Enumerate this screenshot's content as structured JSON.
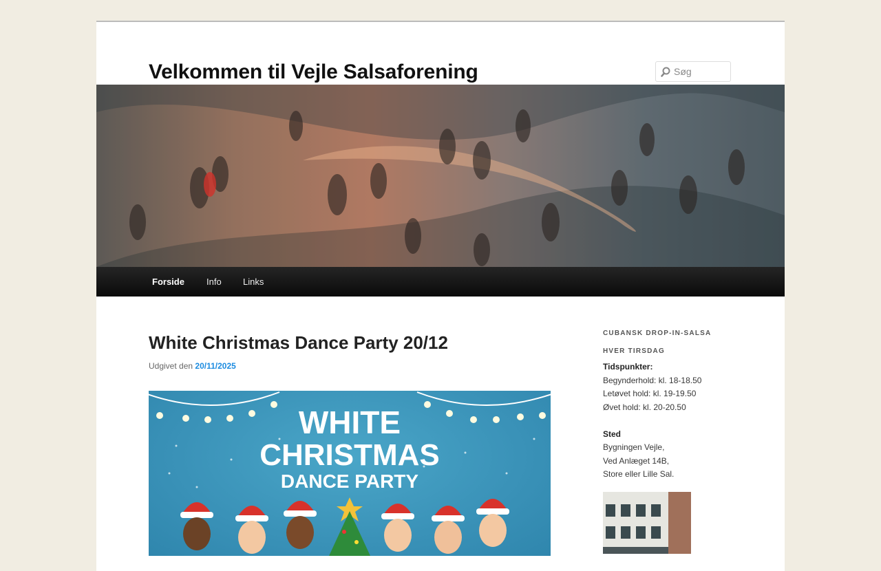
{
  "site": {
    "title": "Velkommen til Vejle Salsaforening"
  },
  "search": {
    "placeholder": "Søg",
    "icon": "search-icon"
  },
  "nav": {
    "items": [
      {
        "label": "Forside",
        "active": true
      },
      {
        "label": "Info",
        "active": false
      },
      {
        "label": "Links",
        "active": false
      }
    ]
  },
  "post": {
    "title": "White Christmas Dance Party 20/12",
    "meta_prefix": "Udgivet den",
    "date": "20/11/2025",
    "poster": {
      "line1": "WHITE",
      "line2": "CHRISTMAS",
      "line3": "DANCE PARTY"
    }
  },
  "sidebar": {
    "widget_title_1": "CUBANSK DROP-IN-SALSA",
    "widget_title_2": "HVER TIRSDAG",
    "times_heading": "Tidspunkter:",
    "times": [
      "Begynderhold: kl. 18-18.50",
      "Letøvet hold: kl. 19-19.50",
      "Øvet hold: kl. 20-20.50"
    ],
    "place_heading": "Sted",
    "place": [
      "Bygningen Vejle,",
      "Ved Anlæget 14B,",
      "Store eller Lille Sal."
    ]
  },
  "colors": {
    "background": "#f1ede2",
    "navbar": "#111111",
    "link": "#1b8be0",
    "poster_blue": "#3a92b8"
  }
}
